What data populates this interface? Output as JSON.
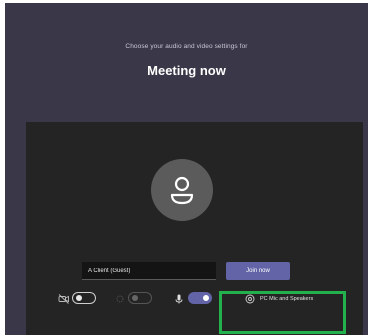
{
  "header": {
    "subtitle": "Choose your audio and video settings for",
    "title": "Meeting now"
  },
  "prejoin": {
    "name_value": "A Client (Guest)",
    "join_label": "Join now",
    "audio_option_label": "PC Mic and Speakers"
  },
  "controls": {
    "camera_toggle": "off",
    "blur_toggle": "off",
    "mic_toggle": "on"
  },
  "icons": {
    "avatar": "person-icon",
    "camera": "camera-off-icon",
    "blur": "background-blur-icon",
    "mic": "microphone-icon",
    "audio_device": "settings-gear-icon"
  },
  "colors": {
    "header_bg": "#3a3848",
    "stage_bg": "#242424",
    "accent": "#6264a7",
    "highlight": "#22b14c"
  }
}
